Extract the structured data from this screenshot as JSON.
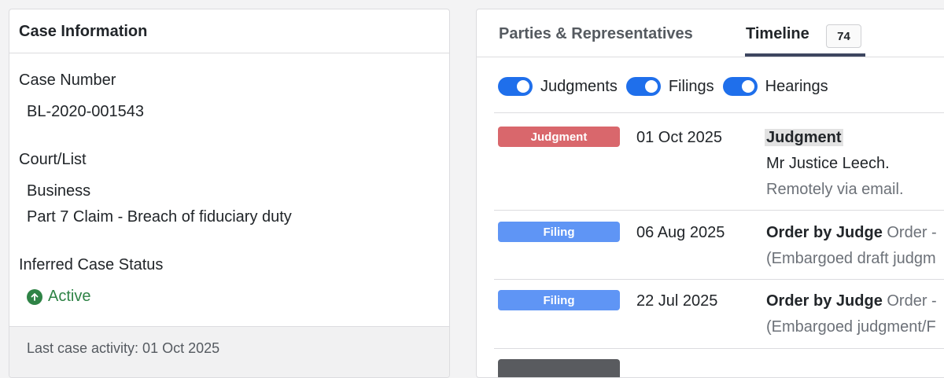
{
  "case_info": {
    "header": "Case Information",
    "case_number_label": "Case Number",
    "case_number": "BL-2020-001543",
    "court_label": "Court/List",
    "court_list": "Business",
    "claim_type": "Part 7 Claim - Breach of fiduciary duty",
    "status_label": "Inferred Case Status",
    "status": "Active",
    "status_icon": "arrow-up-circle-icon",
    "status_color": "#2f8346",
    "last_activity": "Last case activity: 01 Oct 2025"
  },
  "tabs": {
    "parties": "Parties & Representatives",
    "timeline": "Timeline",
    "timeline_count": "74"
  },
  "filters": [
    {
      "label": "Judgments",
      "enabled": true
    },
    {
      "label": "Filings",
      "enabled": true
    },
    {
      "label": "Hearings",
      "enabled": true
    }
  ],
  "timeline": [
    {
      "badge": "Judgment",
      "badge_color": "#d9676c",
      "date": "01 Oct 2025",
      "title": "Judgment",
      "title_rest": "",
      "line2": "Mr Justice Leech.",
      "line3": "Remotely via email."
    },
    {
      "badge": "Filing",
      "badge_color": "#5f95f5",
      "date": "06 Aug 2025",
      "title": "Order by Judge",
      "title_rest": "Order -",
      "line2": "(Embargoed draft judgm"
    },
    {
      "badge": "Filing",
      "badge_color": "#5f95f5",
      "date": "22 Jul 2025",
      "title": "Order by Judge",
      "title_rest": "Order -",
      "line2": "(Embargoed judgment/F"
    }
  ],
  "colors": {
    "toggle_on": "#1f6feb",
    "tab_active_underline": "#3d4660"
  }
}
